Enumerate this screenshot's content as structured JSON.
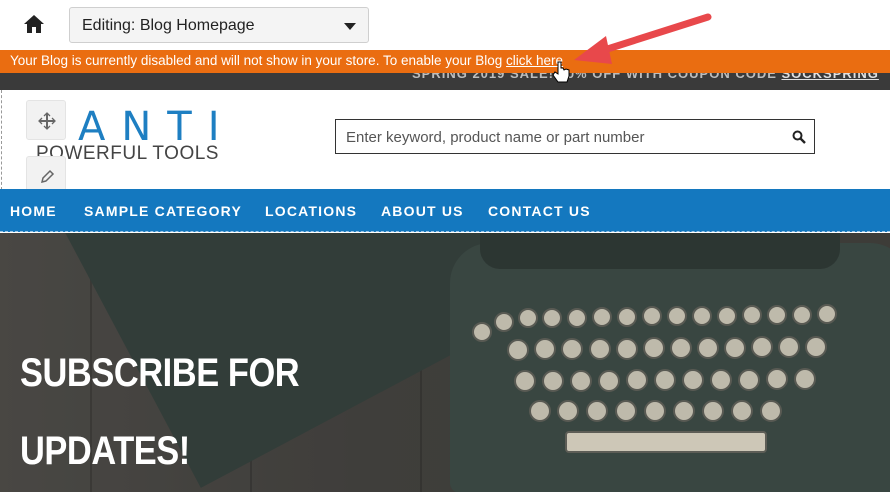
{
  "editor": {
    "home_icon": "home-icon",
    "page_select_value": "Editing: Blog Homepage"
  },
  "warning": {
    "message": "Your Blog is currently disabled and will not show in your store. To enable your Blog ",
    "link_label": "click here"
  },
  "promo": {
    "text": "SPRING 2019 SALE! 20% OFF WITH COUPON CODE ",
    "code": "SOCKSPRING"
  },
  "logo": {
    "main": "ANTI",
    "sub": "POWERFUL TOOLS"
  },
  "search": {
    "placeholder": "Enter keyword, product name or part number"
  },
  "nav": {
    "items": [
      "HOME",
      "SAMPLE CATEGORY",
      "LOCATIONS",
      "ABOUT US",
      "CONTACT US"
    ]
  },
  "hero": {
    "line1": "SUBSCRIBE FOR",
    "line2": "UPDATES!"
  },
  "colors": {
    "warning_bg": "#ea6d11",
    "nav_bg": "#1478bf",
    "logo": "#1e7fc2",
    "arrow": "#e8484b"
  }
}
